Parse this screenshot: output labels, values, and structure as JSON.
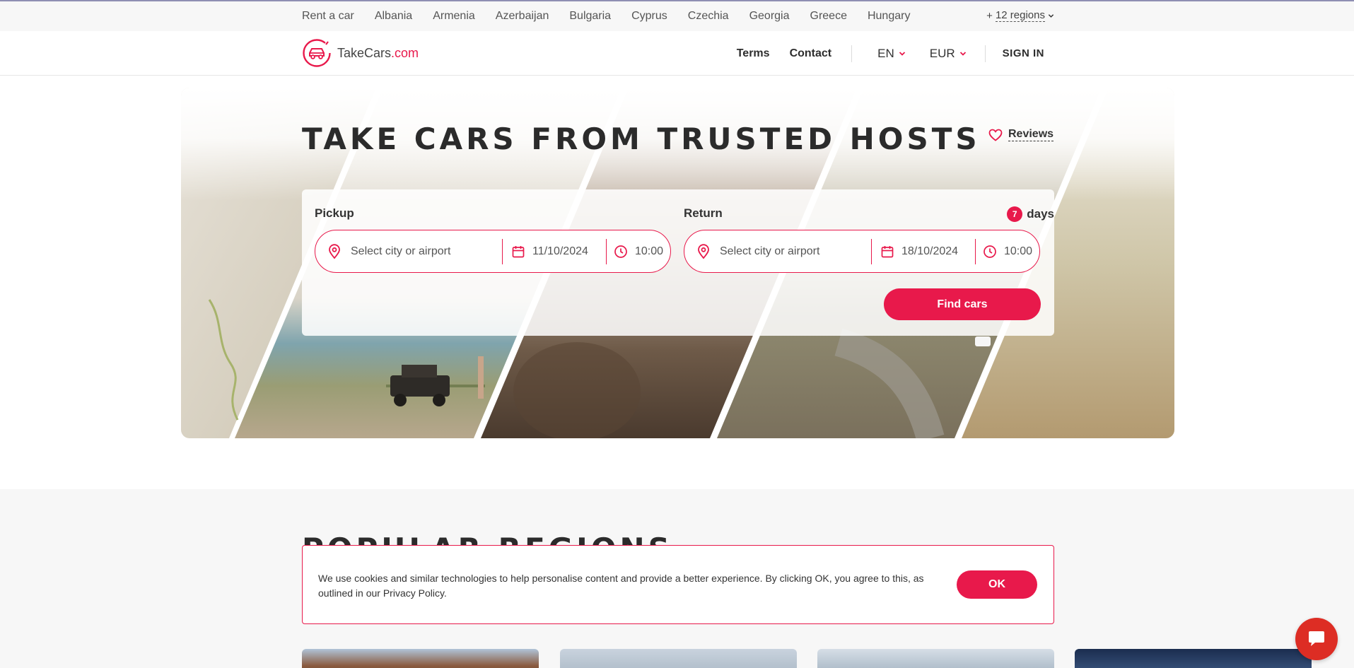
{
  "top_regions": {
    "items": [
      "Rent a car",
      "Albania",
      "Armenia",
      "Azerbaijan",
      "Bulgaria",
      "Cyprus",
      "Czechia",
      "Georgia",
      "Greece",
      "Hungary"
    ],
    "more_prefix": "+",
    "more_label": "12 regions"
  },
  "header": {
    "logo_name": "TakeCars",
    "logo_tld": ".com",
    "nav": {
      "terms": "Terms",
      "contact": "Contact"
    },
    "language": "EN",
    "currency": "EUR",
    "sign_in": "SIGN IN"
  },
  "hero": {
    "title": "TAKE CARS FROM TRUSTED HOSTS",
    "reviews_label": "Reviews"
  },
  "search": {
    "pickup_label": "Pickup",
    "return_label": "Return",
    "days_count": "7",
    "days_label": "days",
    "pickup": {
      "city_placeholder": "Select city or airport",
      "date": "11/10/2024",
      "time": "10:00"
    },
    "return": {
      "city_placeholder": "Select city or airport",
      "date": "18/10/2024",
      "time": "10:00"
    },
    "find_button": "Find cars"
  },
  "popular": {
    "title": "POPULAR REGIONS"
  },
  "cookie": {
    "text": "We use cookies and similar technologies to help personalise content and provide a better experience. By clicking OK, you agree to this, as outlined in our Privacy Policy.",
    "ok_button": "OK"
  },
  "colors": {
    "accent": "#e8194b",
    "chat": "#dd2d24",
    "text_dark": "#2b2b2b"
  },
  "icons": [
    "logo-car-icon",
    "chevron-down-icon",
    "heart-icon",
    "location-pin-icon",
    "calendar-icon",
    "clock-icon",
    "chat-icon"
  ]
}
